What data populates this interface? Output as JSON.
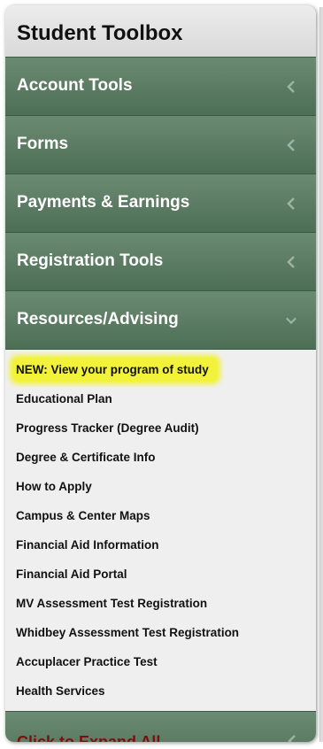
{
  "toolbox": {
    "title": "Student Toolbox",
    "sections": [
      {
        "label": "Account Tools",
        "state": "collapsed"
      },
      {
        "label": "Forms",
        "state": "collapsed"
      },
      {
        "label": "Payments & Earnings",
        "state": "collapsed"
      },
      {
        "label": "Registration Tools",
        "state": "collapsed"
      },
      {
        "label": "Resources/Advising",
        "state": "expanded"
      }
    ],
    "resources_links": [
      "NEW: View your program of study",
      "Educational Plan",
      "Progress Tracker (Degree Audit)",
      "Degree & Certificate Info",
      "How to Apply",
      "Campus & Center Maps",
      "Financial Aid Information",
      "Financial Aid Portal",
      "MV Assessment Test Registration",
      "Whidbey Assessment Test Registration",
      "Accuplacer Practice Test",
      "Health Services"
    ],
    "expand_all_label": "Click to Expand All"
  },
  "colors": {
    "section_green": "#5a7a62",
    "highlight_yellow": "#f2f23a",
    "expand_all_text": "#7a1010"
  },
  "icons": {
    "collapsed": "chevron-left-icon",
    "expanded": "chevron-down-icon"
  }
}
